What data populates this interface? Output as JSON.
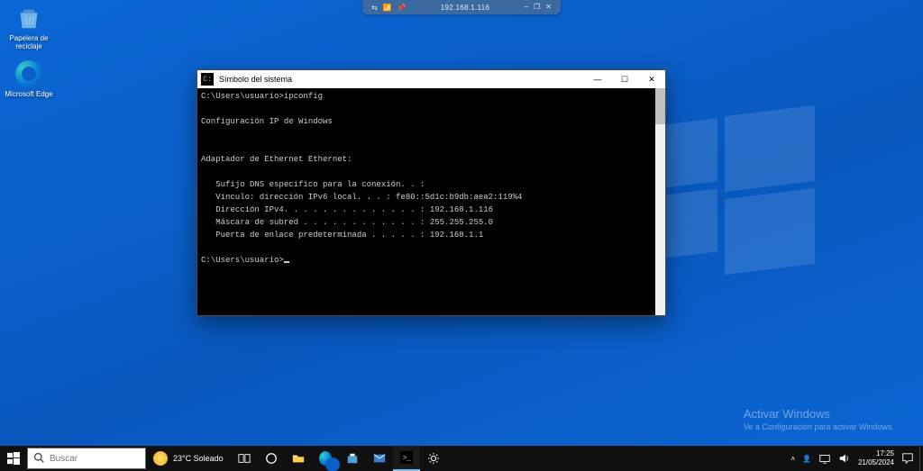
{
  "viewer": {
    "ip": "192.168.1.116",
    "icons_left": [
      "signal-icon",
      "pin-icon",
      "volume-icon"
    ],
    "icons_right": [
      "minimize",
      "restore",
      "close"
    ]
  },
  "desktop": {
    "icons": [
      {
        "name": "recycle-bin",
        "label": "Papelera de reciclaje"
      },
      {
        "name": "edge",
        "label": "Microsoft Edge"
      }
    ]
  },
  "watermark": {
    "line1": "Activar Windows",
    "line2": "Ve a Configuración para activar Windows."
  },
  "cmd": {
    "title": "Símbolo del sistema",
    "lines": [
      "C:\\Users\\usuario>ipconfig",
      "",
      "Configuración IP de Windows",
      "",
      "",
      "Adaptador de Ethernet Ethernet:",
      "",
      "   Sufijo DNS específico para la conexión. . :",
      "   Vínculo: dirección IPv6 local. . . : fe80::5d1c:b9db:aea2:119%4",
      "   Dirección IPv4. . . . . . . . . . . . . . : 192.168.1.116",
      "   Máscara de subred . . . . . . . . . . . . : 255.255.255.0",
      "   Puerta de enlace predeterminada . . . . . : 192.168.1.1",
      "",
      "C:\\Users\\usuario>"
    ]
  },
  "taskbar": {
    "search_placeholder": "Buscar",
    "weather_temp": "23°C",
    "weather_text": "Soleado",
    "clock_time": "17:25",
    "clock_date": "21/05/2024",
    "pinned": [
      "task-view",
      "cortana",
      "explorer",
      "edge",
      "store",
      "mail",
      "cmd",
      "settings"
    ]
  }
}
